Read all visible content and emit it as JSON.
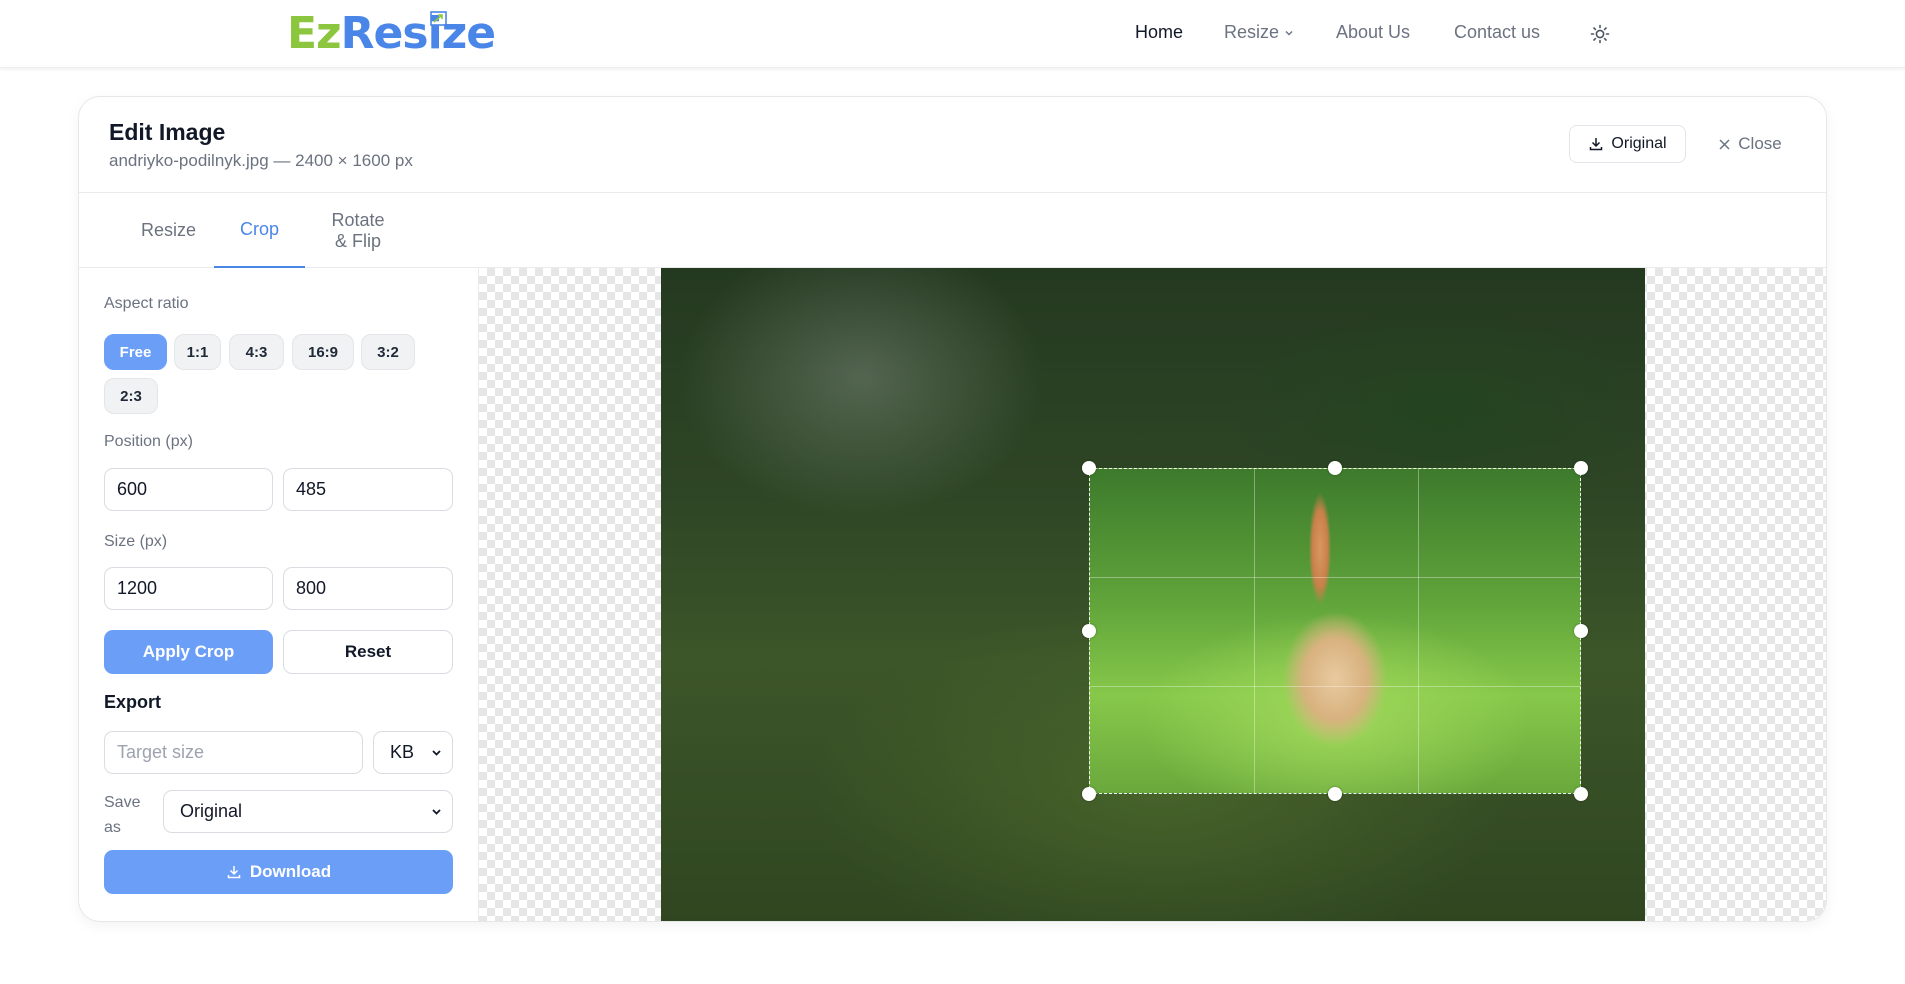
{
  "brand": {
    "part1": "Ez",
    "part2": "Resize"
  },
  "nav": {
    "home": "Home",
    "resize": "Resize",
    "about": "About Us",
    "contact": "Contact us"
  },
  "editor": {
    "title": "Edit Image",
    "file_info": "andriyko-podilnyk.jpg — 2400 × 1600 px",
    "original_button": "Original",
    "close_button": "Close",
    "tabs": [
      {
        "label": "Resize",
        "active": false
      },
      {
        "label": "Crop",
        "active": true
      },
      {
        "label": "Rotate & Flip",
        "active": false
      }
    ]
  },
  "crop_panel": {
    "aspect_label": "Aspect ratio",
    "ratios": [
      "Free",
      "1:1",
      "4:3",
      "16:9",
      "3:2",
      "2:3"
    ],
    "selected_ratio": "Free",
    "position_label": "Position (px)",
    "position_x": "600",
    "position_y": "485",
    "size_label": "Size (px)",
    "width": "1200",
    "height": "800",
    "apply_label": "Apply Crop",
    "reset_label": "Reset"
  },
  "export": {
    "title": "Export",
    "target_placeholder": "Target size",
    "unit": "KB",
    "save_as_label": "Save as",
    "save_as_value": "Original",
    "download_label": "Download"
  },
  "colors": {
    "accent": "#6b9ef7",
    "brand_green": "#8cc63f",
    "brand_blue": "#4a86e8"
  }
}
